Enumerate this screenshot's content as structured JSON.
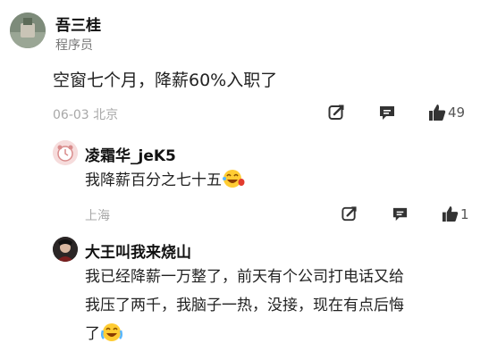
{
  "post": {
    "author": "吾三桂",
    "role": "程序员",
    "content": "空窗七个月，降薪60%入职了",
    "meta": "06-03 北京",
    "like_count": "49"
  },
  "replies": [
    {
      "author": "凌霜华_jeK5",
      "content": "我降薪百分之七十五",
      "emoji": "laugh-cry-emoji",
      "location": "上海",
      "like_count": "1"
    },
    {
      "author": "大王叫我来烧山",
      "content_line1": "我已经降薪一万整了，前天有个公司打电话又给",
      "content_line2": "我压了两千，我脑子一热，没接，现在有点后悔",
      "content_line3": "了",
      "emoji": "laugh-cry-emoji"
    }
  ]
}
